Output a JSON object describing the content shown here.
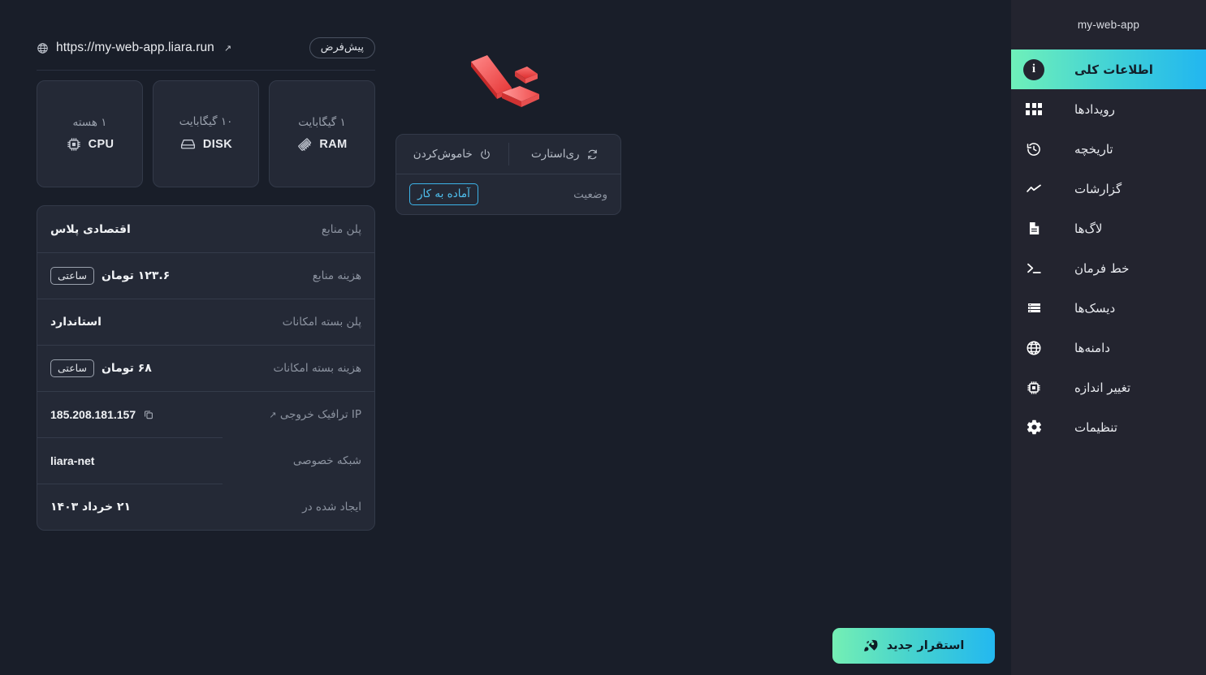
{
  "app": {
    "name": "my-web-app"
  },
  "sidebar": {
    "title": "my-web-app",
    "items": [
      {
        "label": "اطلاعات کلی",
        "icon": "info-circle-icon",
        "active": true
      },
      {
        "label": "رویدادها",
        "icon": "grid-icon",
        "active": false
      },
      {
        "label": "تاریخچه",
        "icon": "history-clock-icon",
        "active": false
      },
      {
        "label": "گزارشات",
        "icon": "line-chart-icon",
        "active": false
      },
      {
        "label": "لاگ‌ها",
        "icon": "document-icon",
        "active": false
      },
      {
        "label": "خط فرمان",
        "icon": "terminal-icon",
        "active": false
      },
      {
        "label": "دیسک‌ها",
        "icon": "server-list-icon",
        "active": false
      },
      {
        "label": "دامنه‌ها",
        "icon": "globe-icon",
        "active": false
      },
      {
        "label": "تغییر اندازه",
        "icon": "chip-icon",
        "active": false
      },
      {
        "label": "تنظیمات",
        "icon": "gear-icon",
        "active": false
      }
    ]
  },
  "url_bar": {
    "icon": "globe-icon",
    "url": "https://my-web-app.liara.run",
    "external_arrow": "↗",
    "default_chip": "پیش‌فرض"
  },
  "stats": [
    {
      "value": "۱ گیگابایت",
      "name": "RAM",
      "icon": "memory-ram-icon"
    },
    {
      "value": "۱۰ گیگابایت",
      "name": "DISK",
      "icon": "hard-disk-icon"
    },
    {
      "value": "۱ هسته",
      "name": "CPU",
      "icon": "cpu-chip-icon"
    }
  ],
  "info_rows": [
    {
      "label": "پلن منابع",
      "value": "اقتصادی پلاس",
      "tag": null,
      "ltr": false,
      "sep": "none",
      "copy": false,
      "label_icon": null
    },
    {
      "label": "هزینه منابع",
      "value": "۱۲۳.۶ تومان",
      "tag": "ساعتی",
      "ltr": false,
      "sep": "full",
      "copy": false,
      "label_icon": null
    },
    {
      "label": "پلن بسته امکانات",
      "value": "استاندارد",
      "tag": null,
      "ltr": false,
      "sep": "full",
      "copy": false,
      "label_icon": null
    },
    {
      "label": "هزینه بسته امکانات",
      "value": "۶۸ تومان",
      "tag": "ساعتی",
      "ltr": false,
      "sep": "full",
      "copy": false,
      "label_icon": null
    },
    {
      "label": "IP ترافیک خروجی",
      "value": "185.208.181.157",
      "tag": null,
      "ltr": true,
      "sep": "full",
      "copy": true,
      "label_icon": "↗"
    },
    {
      "label": "شبکه خصوصی",
      "value": "liara-net",
      "tag": null,
      "ltr": true,
      "sep": "partial",
      "copy": false,
      "label_icon": null
    },
    {
      "label": "ایجاد شده در",
      "value": "۲۱ خرداد ۱۴۰۳",
      "tag": null,
      "ltr": false,
      "sep": "partial",
      "copy": false,
      "label_icon": null
    }
  ],
  "center": {
    "logo_alt": "laravel-logo",
    "controls": [
      {
        "label": "ری‌استارت",
        "icon": "restart-icon"
      },
      {
        "label": "خاموش‌کردن",
        "icon": "power-icon"
      }
    ],
    "status_label": "وضعیت",
    "status_value": "آماده به کار"
  },
  "deploy_button": {
    "label": "استقرار جدید",
    "icon": "rocket-icon"
  },
  "colors": {
    "page_bg": "#191e29",
    "sidebar_bg": "#23242f",
    "card_bg": "#242936",
    "border": "#333a49",
    "accent_green": "#6ff0b9",
    "accent_blue": "#21b6f0",
    "status_cyan": "#4fc0ef",
    "muted_text": "#8c93a0",
    "primary_text": "#f0f2f5",
    "logo_red": "#f05252"
  }
}
